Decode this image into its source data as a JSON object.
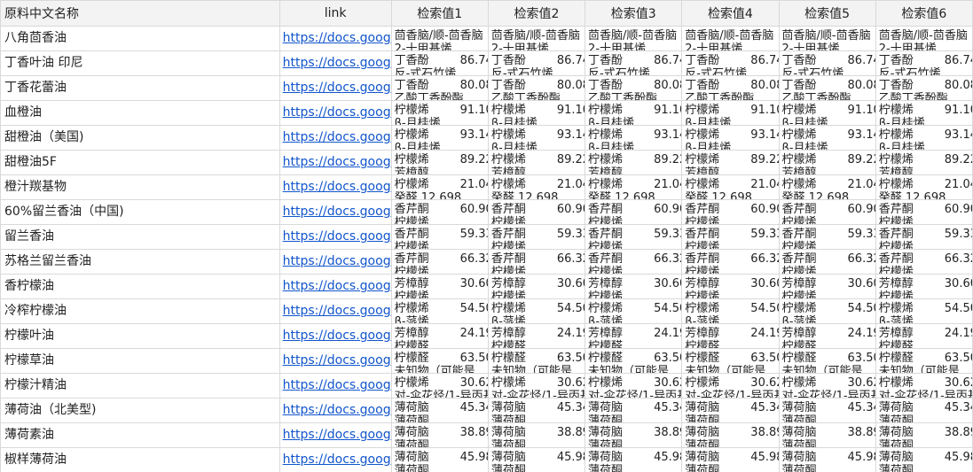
{
  "sheet": {
    "headers": [
      "原料中文名称",
      "link",
      "检索值1",
      "检索值2",
      "检索值3",
      "检索值4",
      "检索值5",
      "检索值6"
    ],
    "rows": [
      {
        "name": "八角茴香油",
        "link": "https://docs.goog",
        "v": "茴香脑/顺-茴香脑",
        "n": "",
        "s": "2-十甲基烯"
      },
      {
        "name": "丁香叶油 印尼",
        "link": "https://docs.goog",
        "v": "丁香酚",
        "n": "86.74",
        "s": "反-式石竹烯"
      },
      {
        "name": "丁香花蕾油",
        "link": "https://docs.goog",
        "v": "丁香酚",
        "n": "80.08",
        "s": "乙酸丁香酚酯"
      },
      {
        "name": "血橙油",
        "link": "https://docs.goog",
        "v": "柠檬烯",
        "n": "91.10",
        "s": "β-月桂烯"
      },
      {
        "name": "甜橙油（美国)",
        "link": "https://docs.goog",
        "v": "柠檬烯",
        "n": "93.14",
        "s": "β-月桂烯"
      },
      {
        "name": "甜橙油5F",
        "link": "https://docs.goog",
        "v": "柠檬烯",
        "n": "89.22",
        "s": "芳樟醇"
      },
      {
        "name": "橙汁羰基物",
        "link": "https://docs.goog",
        "v": "柠檬烯",
        "n": "21.04",
        "s": "癸醛 12.698"
      },
      {
        "name": "60%留兰香油（中国)",
        "link": "https://docs.goog",
        "v": "香芹酮",
        "n": "60.90",
        "s": "柠檬烯"
      },
      {
        "name": "留兰香油",
        "link": "https://docs.goog",
        "v": "香芹酮",
        "n": "59.33",
        "s": "柠檬烯"
      },
      {
        "name": "苏格兰留兰香油",
        "link": "https://docs.goog",
        "v": "香芹酮",
        "n": "66.32",
        "s": "柠檬烯"
      },
      {
        "name": "香柠檬油",
        "link": "https://docs.goog",
        "v": "芳樟醇",
        "n": "30.60",
        "s": "柠檬烯"
      },
      {
        "name": "冷榨柠檬油",
        "link": "https://docs.goog",
        "v": "柠檬烯",
        "n": "54.50",
        "s": "β-蒎烯"
      },
      {
        "name": "柠檬叶油",
        "link": "https://docs.goog",
        "v": "芳樟醇",
        "n": "24.19",
        "s": "柠檬醛"
      },
      {
        "name": "柠檬草油",
        "link": "https://docs.goog",
        "v": "柠檬醛",
        "n": "63.50",
        "s": "未知物（可能是"
      },
      {
        "name": "柠檬汁精油",
        "link": "https://docs.goog",
        "v": "柠檬烯",
        "n": "30.62",
        "s": "对-伞花烃/1-异丙基"
      },
      {
        "name": "薄荷油（北美型)",
        "link": "https://docs.goog",
        "v": "薄荷脑",
        "n": "45.34",
        "s": "薄荷酮"
      },
      {
        "name": "薄荷素油",
        "link": "https://docs.goog",
        "v": "薄荷脑",
        "n": "38.89",
        "s": "薄荷酮"
      },
      {
        "name": "椒样薄荷油",
        "link": "https://docs.goog",
        "v": "薄荷脑",
        "n": "45.98",
        "s": "薄荷酮"
      }
    ]
  }
}
